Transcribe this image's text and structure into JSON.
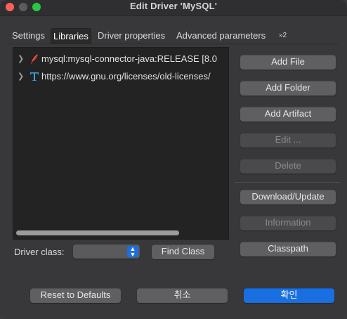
{
  "window": {
    "title": "Edit Driver 'MySQL'"
  },
  "tabs": [
    {
      "label": "Settings",
      "active": false
    },
    {
      "label": "Libraries",
      "active": true
    },
    {
      "label": "Driver properties",
      "active": false
    },
    {
      "label": "Advanced parameters",
      "active": false
    },
    {
      "label": "»2",
      "active": false
    }
  ],
  "libraries": [
    {
      "icon": "maven-feather-icon",
      "label": "mysql:mysql-connector-java:RELEASE [8.0"
    },
    {
      "icon": "license-text-icon",
      "label": "https://www.gnu.org/licenses/old-licenses/"
    }
  ],
  "side_buttons": {
    "add_file": "Add File",
    "add_folder": "Add Folder",
    "add_artifact": "Add Artifact",
    "edit": "Edit ...",
    "delete": "Delete",
    "download_update": "Download/Update",
    "information": "Information",
    "classpath": "Classpath"
  },
  "driver_class": {
    "label": "Driver class:",
    "value": "",
    "find_class": "Find Class"
  },
  "footer": {
    "reset": "Reset to Defaults",
    "cancel": "취소",
    "ok": "확인"
  },
  "colors": {
    "accent": "#1a6fe0",
    "close": "#fe5f57",
    "maximize": "#28c840"
  }
}
